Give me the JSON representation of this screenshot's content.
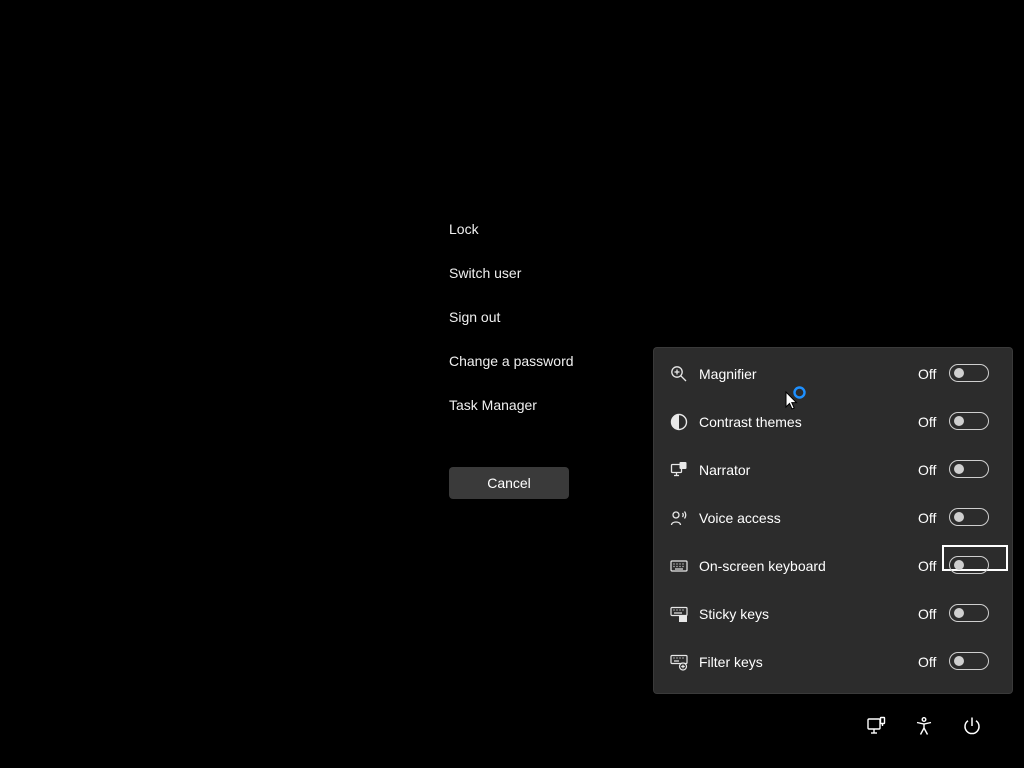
{
  "security_menu": {
    "items": [
      {
        "label": "Lock"
      },
      {
        "label": "Switch user"
      },
      {
        "label": "Sign out"
      },
      {
        "label": "Change a password"
      },
      {
        "label": "Task Manager"
      }
    ],
    "cancel_label": "Cancel"
  },
  "accessibility": {
    "items": [
      {
        "label": "Magnifier",
        "state": "Off",
        "icon": "magnifier-icon",
        "on": false
      },
      {
        "label": "Contrast themes",
        "state": "Off",
        "icon": "contrast-icon",
        "on": false
      },
      {
        "label": "Narrator",
        "state": "Off",
        "icon": "narrator-icon",
        "on": false
      },
      {
        "label": "Voice access",
        "state": "Off",
        "icon": "voice-access-icon",
        "on": false
      },
      {
        "label": "On-screen keyboard",
        "state": "Off",
        "icon": "keyboard-icon",
        "on": false,
        "focused": true
      },
      {
        "label": "Sticky keys",
        "state": "Off",
        "icon": "sticky-keys-icon",
        "on": false
      },
      {
        "label": "Filter keys",
        "state": "Off",
        "icon": "filter-keys-icon",
        "on": false
      }
    ]
  },
  "tray": {
    "icons": [
      "network-icon",
      "accessibility-icon",
      "power-icon"
    ]
  },
  "colors": {
    "background": "#000000",
    "panel": "#2c2c2c",
    "button": "#3a3a3a",
    "text": "#ffffff",
    "busy_accent": "#1e90ff"
  }
}
